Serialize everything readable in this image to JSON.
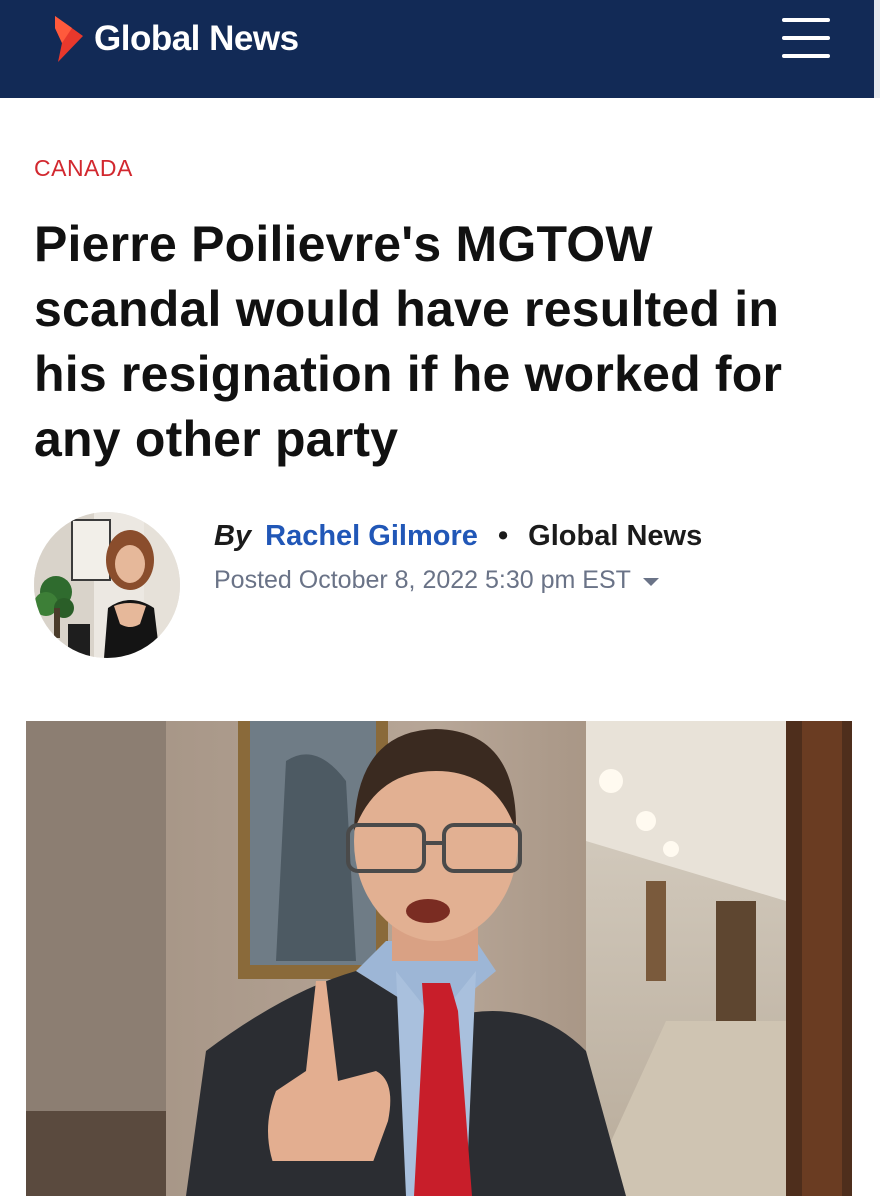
{
  "header": {
    "brand": "Global News",
    "brand_color": "#122a56",
    "logo_icon": "chevron-logo-icon",
    "menu_icon": "hamburger-menu-icon"
  },
  "article": {
    "section": "CANADA",
    "headline": "Pierre Poilievre's MGTOW scandal would have resulted in his resignation if he worked for any other party",
    "byline": {
      "prefix": "By",
      "author": "Rachel Gilmore",
      "separator": "•",
      "outlet": "Global News",
      "posted": "Posted October 8, 2022 5:30 pm EST"
    }
  },
  "colors": {
    "section_red": "#d2282f",
    "author_blue": "#2157b7",
    "meta_gray": "#6a7387"
  }
}
